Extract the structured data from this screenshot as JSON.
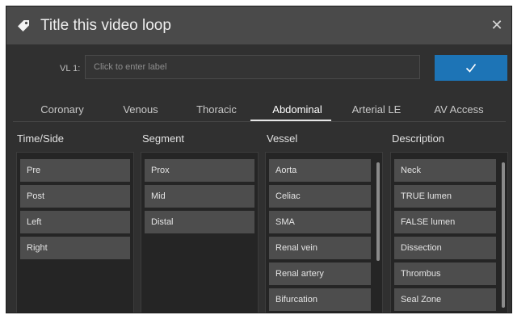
{
  "dialog": {
    "title": "Title this video loop",
    "title_icon": "tag-icon",
    "close_icon": "close-icon",
    "close_glyph": "✕"
  },
  "label_field": {
    "label": "VL 1:",
    "placeholder": "Click to enter label",
    "value": ""
  },
  "confirm_button": {
    "icon": "checkmark-icon",
    "color": "#1d74b6"
  },
  "tabs": [
    {
      "label": "Coronary",
      "active": false
    },
    {
      "label": "Venous",
      "active": false
    },
    {
      "label": "Thoracic",
      "active": false
    },
    {
      "label": "Abdominal",
      "active": true
    },
    {
      "label": "Arterial LE",
      "active": false
    },
    {
      "label": "AV Access",
      "active": false
    }
  ],
  "columns": [
    {
      "header": "Time/Side",
      "items": [
        "Pre",
        "Post",
        "Left",
        "Right"
      ]
    },
    {
      "header": "Segment",
      "items": [
        "Prox",
        "Mid",
        "Distal"
      ]
    },
    {
      "header": "Vessel",
      "items": [
        "Aorta",
        "Celiac",
        "SMA",
        "Renal vein",
        "Renal artery",
        "Bifurcation"
      ]
    },
    {
      "header": "Description",
      "items": [
        "Neck",
        "TRUE lumen",
        "FALSE lumen",
        "Dissection",
        "Thrombus",
        "Seal Zone"
      ]
    }
  ]
}
